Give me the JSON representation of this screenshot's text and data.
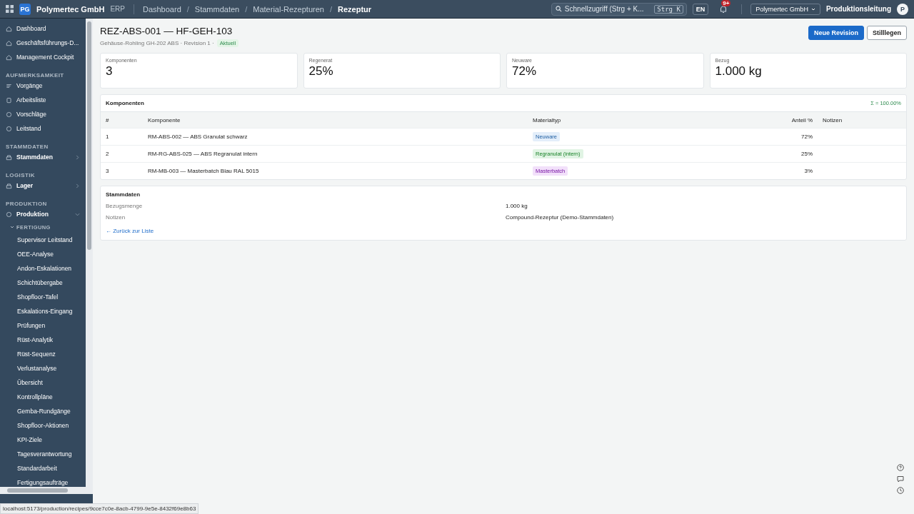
{
  "topbar": {
    "logo": "PG",
    "company": "Polymertec GmbH",
    "suffix": "ERP",
    "breadcrumbs": [
      {
        "label": "Dashboard",
        "current": false
      },
      {
        "separator": "/",
        "label": "Stammdaten",
        "current": false
      },
      {
        "separator": "/",
        "label": "Material-Rezepturen",
        "current": false
      },
      {
        "separator": "/",
        "label": "Rezeptur",
        "current": true
      }
    ],
    "search": {
      "placeholder": "Schnellzugriff (Strg + K...",
      "shortcut": "Strg K"
    },
    "language": "EN",
    "notifications": "9+",
    "tenant": "Polymertec GmbH",
    "role": "Produktionsleitung",
    "avatar": "P"
  },
  "sidebar": {
    "sections": [
      {
        "items": [
          {
            "label": "Dashboard"
          },
          {
            "label": "Geschäftsführungs-D..."
          },
          {
            "label": "Management Cockpit"
          }
        ]
      },
      {
        "title": "AUFMERKSAMKEIT",
        "items": [
          {
            "label": "Vorgänge"
          },
          {
            "label": "Arbeitsliste"
          },
          {
            "label": "Vorschläge"
          },
          {
            "label": "Leitstand"
          }
        ]
      },
      {
        "title": "STAMMDATEN",
        "items": [
          {
            "label": "Stammdaten",
            "expanded": false
          }
        ]
      },
      {
        "title": "LOGISTIK",
        "items": [
          {
            "label": "Lager",
            "expanded": false
          }
        ]
      },
      {
        "title": "PRODUKTION",
        "items": [
          {
            "label": "Produktion",
            "expanded": true,
            "children": [
              {
                "title": "FERTIGUNG",
                "expanded": true,
                "children": [
                  {
                    "label": "Supervisor Leitstand"
                  },
                  {
                    "label": "OEE-Analyse"
                  },
                  {
                    "label": "Andon-Eskalationen"
                  },
                  {
                    "label": "Schichtübergabe"
                  },
                  {
                    "label": "Shopfloor-Tafel"
                  },
                  {
                    "label": "Eskalations-Eingang"
                  },
                  {
                    "label": "Prüfungen"
                  },
                  {
                    "label": "Rüst-Analytik"
                  },
                  {
                    "label": "Rüst-Sequenz"
                  },
                  {
                    "label": "Verlustanalyse"
                  },
                  {
                    "label": "Übersicht"
                  },
                  {
                    "label": "Kontrollpläne"
                  },
                  {
                    "label": "Gemba-Rundgänge"
                  },
                  {
                    "label": "Shopfloor-Aktionen"
                  },
                  {
                    "label": "KPI-Ziele"
                  },
                  {
                    "label": "Tagesverantwortung"
                  },
                  {
                    "label": "Standardarbeit"
                  },
                  {
                    "label": "Fertigungsaufträge"
                  }
                ]
              }
            ]
          }
        ]
      }
    ]
  },
  "page": {
    "title": "REZ-ABS-001 — HF-GEH-103",
    "subtitle": "Gehäuse-Rohling GH-202 ABS · Revision 1 ·",
    "status": "Aktuell",
    "actions": [
      {
        "label": "Neue Revision",
        "kind": "primary"
      },
      {
        "label": "Stilllegen",
        "kind": "secondary"
      }
    ]
  },
  "stats": [
    {
      "label": "Komponenten",
      "value": "3"
    },
    {
      "label": "Regenerat",
      "value": "25%"
    },
    {
      "label": "Neuware",
      "value": "72%"
    },
    {
      "label": "Bezug",
      "value": "1.000 kg"
    }
  ],
  "components": {
    "title": "Komponenten",
    "sum": "Σ = 100.00%",
    "columns": [
      "#",
      "Komponente",
      "Materialtyp",
      "Anteil %",
      "Notizen"
    ],
    "rows": [
      {
        "index": "1",
        "component": "RM-ABS-002 — ABS Granulat schwarz",
        "type": "Neuware",
        "color": "#e3eefa",
        "share": "72%"
      },
      {
        "index": "2",
        "component": "RM-RG-ABS-025 — ABS Regranulat intern",
        "type": "Regranulat (intern)",
        "color": "#e1f4e4",
        "share": "25%"
      },
      {
        "index": "3",
        "component": "RM-MB-003 — Masterbatch Blau RAL 5015",
        "type": "Masterbatch",
        "color": "#f2e0fa",
        "share": "3%"
      }
    ]
  },
  "master": {
    "title": "Stammdaten",
    "fields": [
      {
        "label": "Bezugsmenge",
        "value": "1.000 kg"
      },
      {
        "label": "Notizen",
        "value": "Compound-Rezeptur (Demo-Stammdaten)"
      }
    ],
    "back_link": "← Zurück zur Liste"
  },
  "status_url": "localhost:5173/production/recipes/9cce7c0e-8acb-4799-9e5e-8432f69e8b63"
}
